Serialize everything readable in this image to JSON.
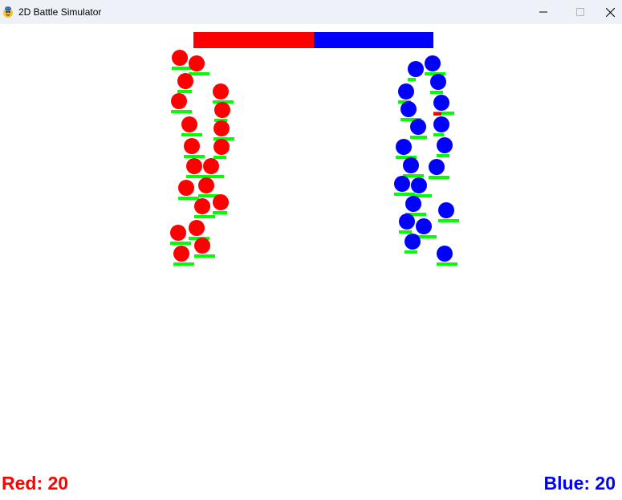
{
  "window": {
    "title": "2D Battle Simulator",
    "app_icon": "pygame-snake-icon",
    "controls": [
      "minimize-icon",
      "maximize-icon",
      "close-icon"
    ]
  },
  "colors": {
    "red_team": "#ff0000",
    "blue_team": "#0000ff",
    "health": "#00ff00",
    "damage": "#ff0000",
    "background": "#ffffff",
    "titlebar": "#eef2f8"
  },
  "army_strength": {
    "red_fraction": 0.5,
    "blue_fraction": 0.5
  },
  "units": {
    "red": [
      {
        "health": 1.0
      },
      {
        "health": 1.0
      },
      {
        "health": 0.7
      },
      {
        "health": 1.0
      },
      {
        "health": 1.0
      },
      {
        "health": 0.6
      },
      {
        "health": 1.0
      },
      {
        "health": 1.0
      },
      {
        "health": 1.0
      },
      {
        "health": 0.6
      },
      {
        "health": 1.0
      },
      {
        "health": 1.0
      },
      {
        "health": 1.0
      },
      {
        "health": 1.0
      },
      {
        "health": 1.0
      },
      {
        "health": 0.7
      },
      {
        "health": 1.0
      },
      {
        "health": 1.0
      },
      {
        "health": 1.0
      },
      {
        "health": 1.0
      }
    ],
    "blue": [
      {
        "health": 0.4
      },
      {
        "health": 1.0
      },
      {
        "health": 0.6
      },
      {
        "health": 0.6
      },
      {
        "health": 1.0
      },
      {
        "health": 1.0
      },
      {
        "health": 0.8
      },
      {
        "health": 0.5
      },
      {
        "health": 1.0
      },
      {
        "health": 0.6
      },
      {
        "health": 1.0
      },
      {
        "health": 1.0
      },
      {
        "health": 1.0
      },
      {
        "health": 1.0
      },
      {
        "health": 1.0
      },
      {
        "health": 1.0
      },
      {
        "health": 0.6
      },
      {
        "health": 1.0
      },
      {
        "health": 0.6
      },
      {
        "health": 1.0
      }
    ]
  },
  "score": {
    "red_label": "Red: 20",
    "blue_label": "Blue: 20"
  }
}
